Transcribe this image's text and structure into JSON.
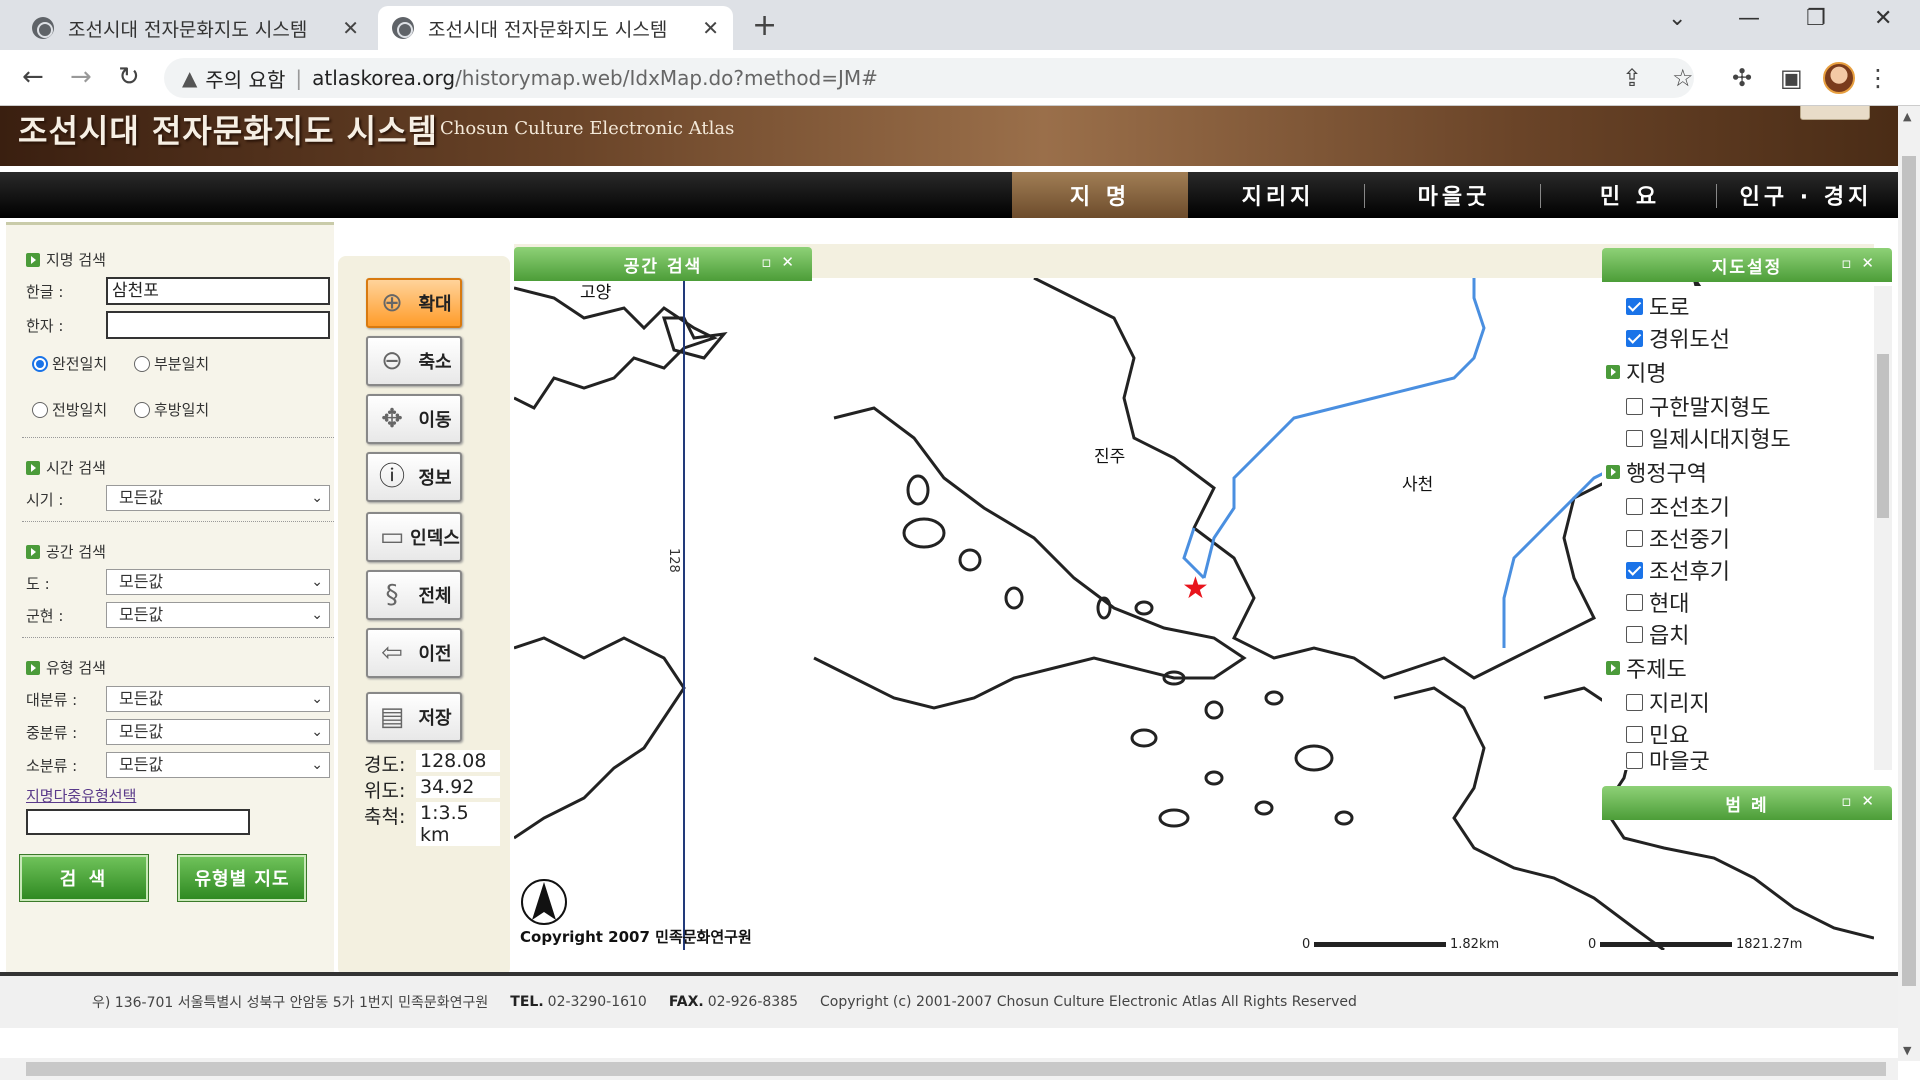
{
  "browser": {
    "tabs": [
      {
        "title": "조선시대 전자문화지도 시스템",
        "active": false
      },
      {
        "title": "조선시대 전자문화지도 시스템",
        "active": true
      }
    ],
    "security_label": "주의 요함",
    "url_host": "atlaskorea.org",
    "url_path": "/historymap.web/IdxMap.do?method=JM#"
  },
  "site": {
    "title_ko": "조선시대 전자문화지도 시스템",
    "title_en": "Chosun Culture Electronic Atlas"
  },
  "menu": [
    "지 명",
    "지리지",
    "마을굿",
    "민 요",
    "인구 · 경지"
  ],
  "search": {
    "name_section": "지명 검색",
    "hangul_label": "한글 :",
    "hangul_value": "삼천포",
    "hanja_label": "한자 :",
    "hanja_value": "",
    "match_options": [
      {
        "label": "완전일치",
        "checked": true
      },
      {
        "label": "부분일치",
        "checked": false
      },
      {
        "label": "전방일치",
        "checked": false
      },
      {
        "label": "후방일치",
        "checked": false
      }
    ],
    "time_section": "시간 검색",
    "period_label": "시기 :",
    "period_value": "모든값",
    "space_section": "공간 검색",
    "province_label": "도 :",
    "province_value": "모든값",
    "county_label": "군현 :",
    "county_value": "모든값",
    "type_section": "유형 검색",
    "major_label": "대분류 :",
    "major_value": "모든값",
    "middle_label": "중분류 :",
    "middle_value": "모든값",
    "minor_label": "소분류 :",
    "minor_value": "모든값",
    "multi_type_link": "지명다중유형선택",
    "multi_type_value": "",
    "search_button": "검 색",
    "type_map_button": "유형별 지도"
  },
  "tools": [
    {
      "label": "확대",
      "icon": "zoom-in-icon"
    },
    {
      "label": "축소",
      "icon": "zoom-out-icon"
    },
    {
      "label": "이동",
      "icon": "move-icon"
    },
    {
      "label": "정보",
      "icon": "info-icon"
    },
    {
      "label": "인덱스",
      "icon": "index-icon"
    },
    {
      "label": "전체",
      "icon": "full-extent-icon"
    },
    {
      "label": "이전",
      "icon": "back-arrow-icon"
    },
    {
      "label": "저장",
      "icon": "save-icon"
    }
  ],
  "coords": {
    "lon_label": "경도:",
    "lon_value": "128.08",
    "lat_label": "위도:",
    "lat_value": "34.92",
    "scale_label": "축척:",
    "scale_value": "1:3.5 km"
  },
  "map": {
    "panel_title": "공간 검색",
    "place_labels": [
      "고양",
      "진주",
      "사천"
    ],
    "meridian_label": "128",
    "copyright": "Copyright 2007 민족문화연구원",
    "scalebar1_zero": "0",
    "scalebar1_label": "1.82km",
    "scalebar2_zero": "0",
    "scalebar2_label": "1821.27m",
    "marker_color": "#e8141c",
    "river_color": "#4a8fe0"
  },
  "map_settings": {
    "title": "지도설정",
    "items": [
      {
        "type": "option",
        "label": "도로",
        "checked": true
      },
      {
        "type": "option",
        "label": "경위도선",
        "checked": true
      },
      {
        "type": "group",
        "label": "지명"
      },
      {
        "type": "option",
        "label": "구한말지형도",
        "checked": false
      },
      {
        "type": "option",
        "label": "일제시대지형도",
        "checked": false
      },
      {
        "type": "group",
        "label": "행정구역"
      },
      {
        "type": "option",
        "label": "조선초기",
        "checked": false
      },
      {
        "type": "option",
        "label": "조선중기",
        "checked": false
      },
      {
        "type": "option",
        "label": "조선후기",
        "checked": true
      },
      {
        "type": "option",
        "label": "현대",
        "checked": false
      },
      {
        "type": "option",
        "label": "읍치",
        "checked": false
      },
      {
        "type": "group",
        "label": "주제도"
      },
      {
        "type": "option",
        "label": "지리지",
        "checked": false
      },
      {
        "type": "option",
        "label": "민요",
        "checked": false
      },
      {
        "type": "option",
        "label": "마을굿",
        "checked": false
      }
    ]
  },
  "legend_title": "범 례",
  "footer": {
    "address": "우) 136-701  서울특별시 성북구 안암동 5가 1번지 민족문화연구원",
    "tel_label": "TEL.",
    "tel": "02-3290-1610",
    "fax_label": "FAX.",
    "fax": "02-926-8385",
    "copyright": "Copyright (c) 2001-2007 Chosun Culture Electronic Atlas  All Rights Reserved"
  }
}
